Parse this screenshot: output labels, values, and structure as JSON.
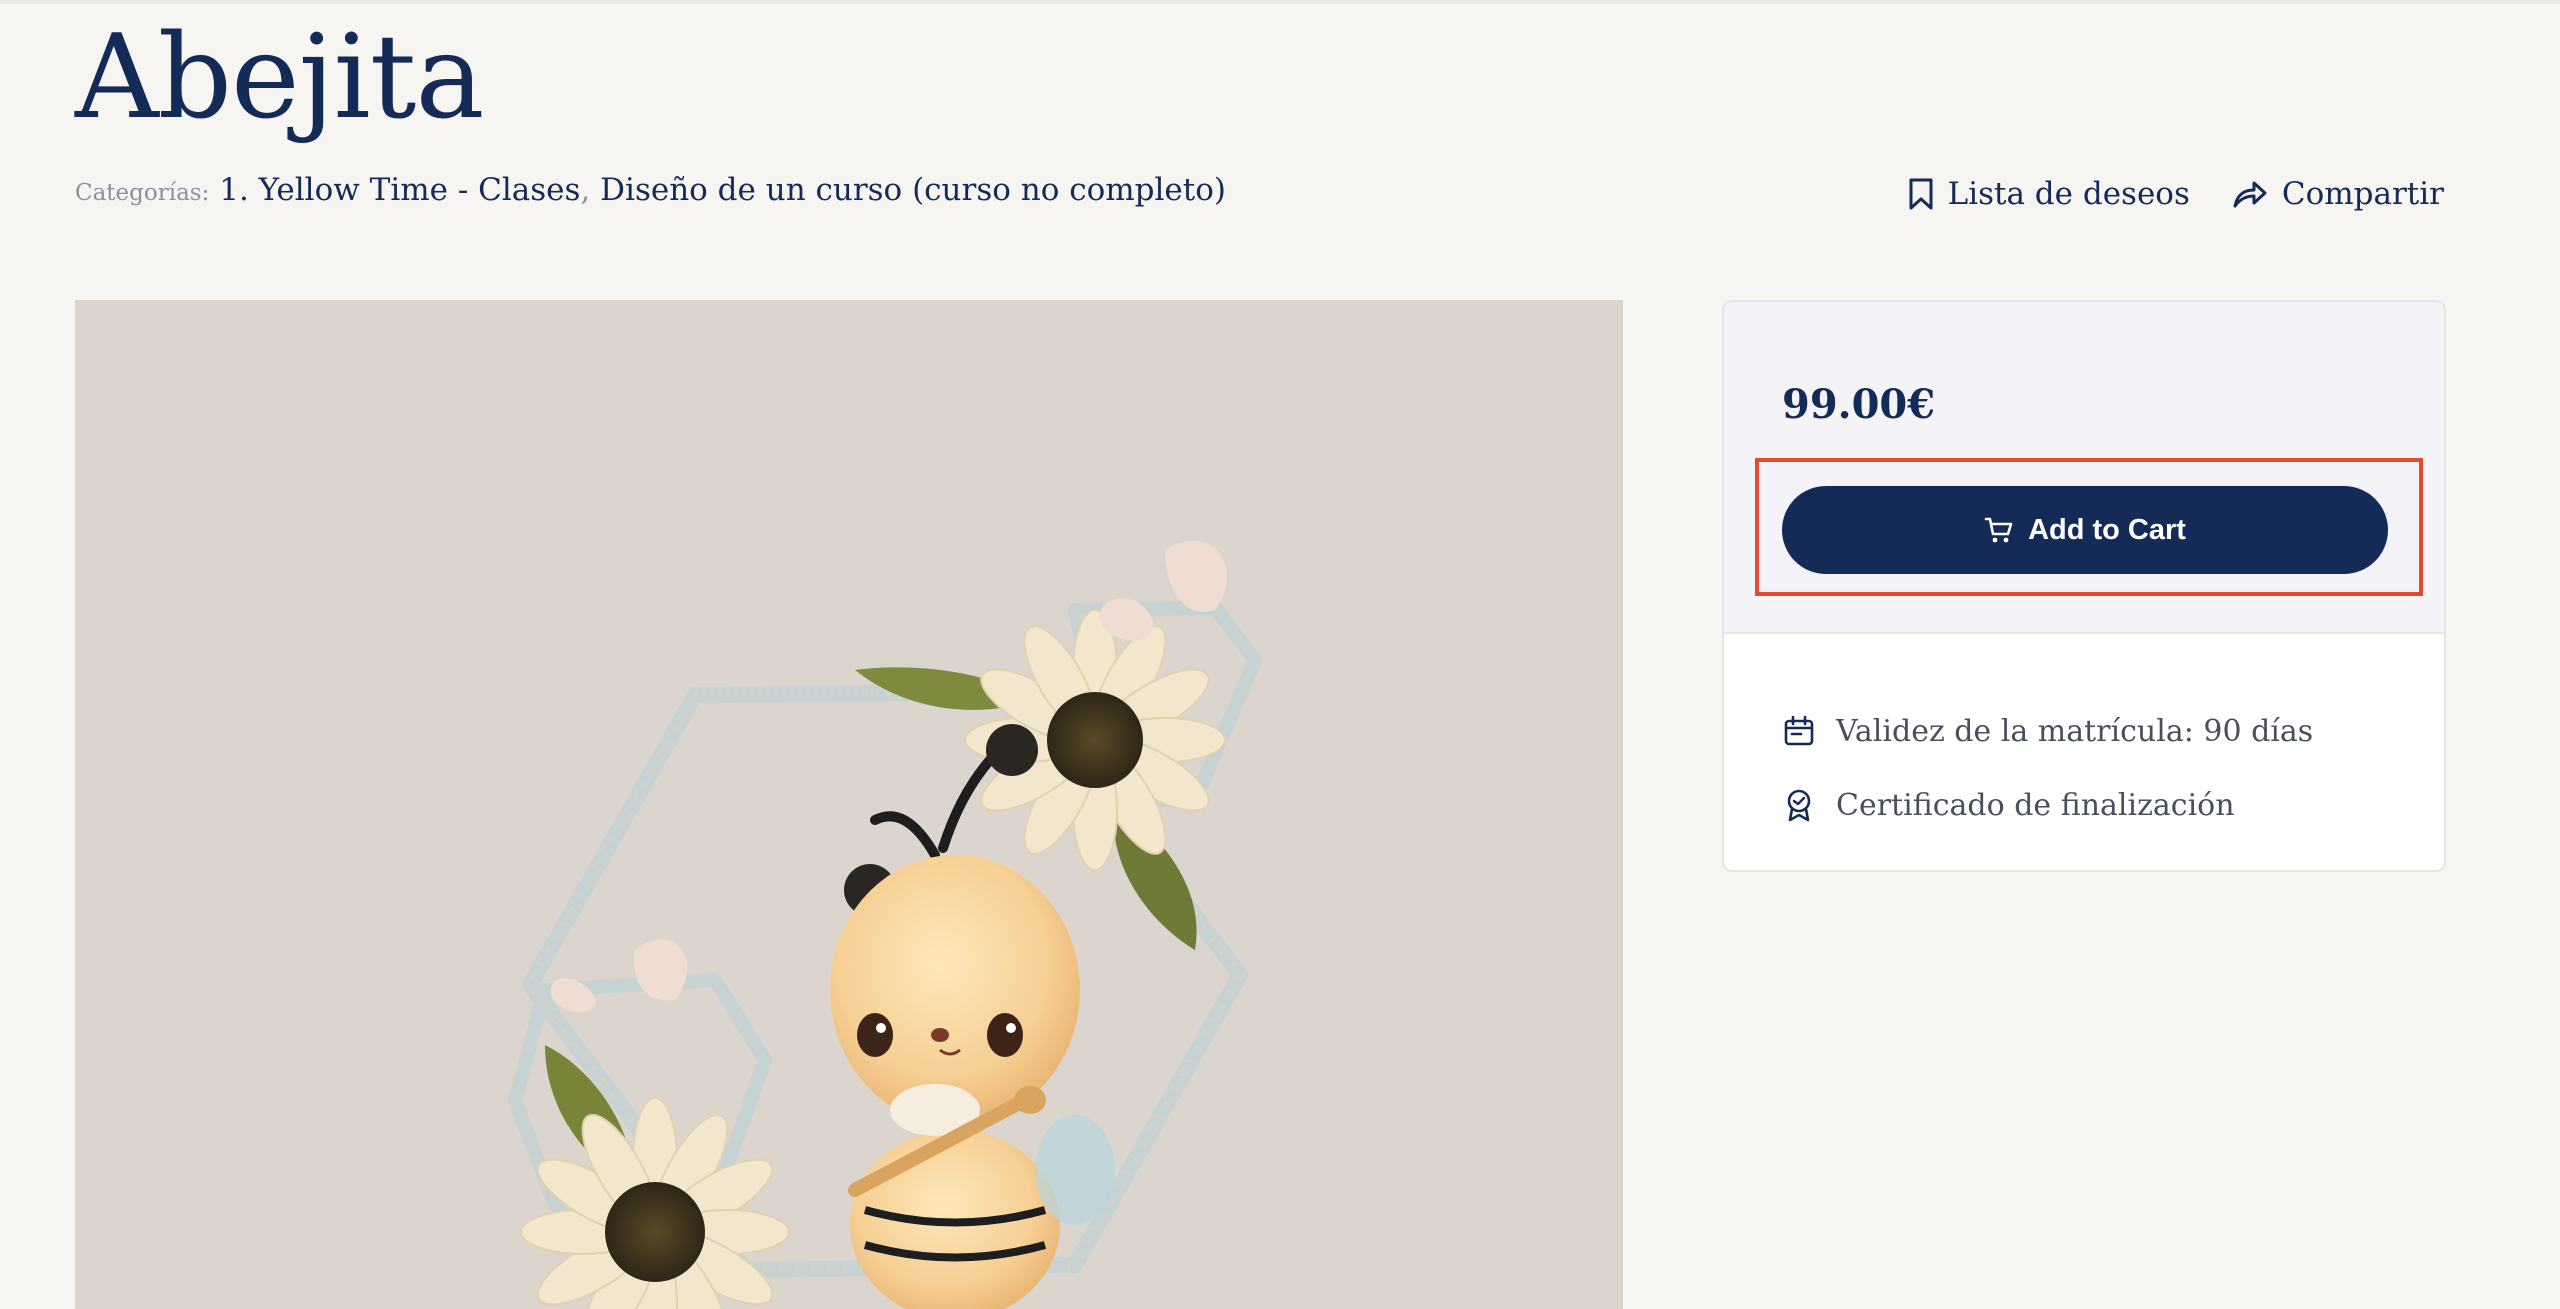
{
  "page": {
    "title": "Abejita"
  },
  "categories": {
    "label": "Categorías:",
    "items": [
      "1. Yellow Time - Clases",
      "Diseño de un curso (curso no completo)"
    ],
    "separator": ","
  },
  "actions": {
    "wishlist": {
      "label": "Lista de deseos",
      "icon": "bookmark-icon"
    },
    "share": {
      "label": "Compartir",
      "icon": "share-icon"
    }
  },
  "product_image": {
    "description_icon": "course-image"
  },
  "pricing": {
    "price": "99.00€",
    "cart_button": {
      "label": "Add to Cart",
      "icon": "cart-icon"
    }
  },
  "features": [
    {
      "icon": "calendar-icon",
      "text": "Validez de la matrícula: 90 días"
    },
    {
      "icon": "certificate-icon",
      "text": "Certificado de finalización"
    }
  ],
  "colors": {
    "primary": "#142a57",
    "background": "#f7f5f2",
    "highlight": "#e24a33",
    "muted": "#8e9099"
  }
}
